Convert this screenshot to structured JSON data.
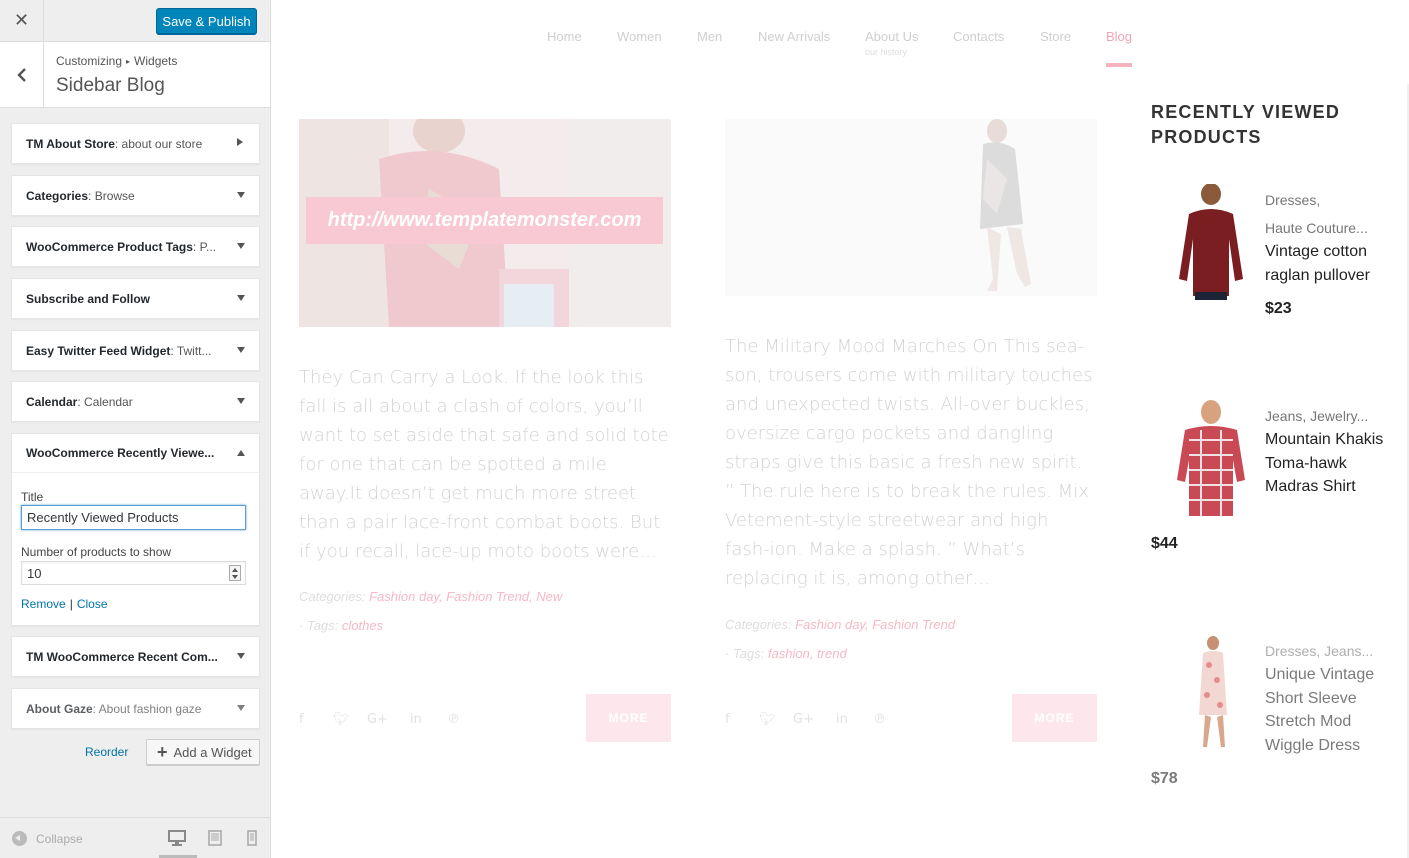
{
  "customizer": {
    "close_icon": "close-icon",
    "save_label": "Save & Publish",
    "breadcrumb": {
      "root": "Customizing",
      "separator": "▸",
      "parent": "Widgets"
    },
    "section_title": "Sidebar Blog",
    "widgets": [
      {
        "name": "TM About Store",
        "title": ": about our store",
        "state": "collapsed-right"
      },
      {
        "name": "Categories",
        "title": ": Browse",
        "state": "collapsed"
      },
      {
        "name": "WooCommerce Product Tags",
        "title": ": P...",
        "state": "collapsed"
      },
      {
        "name": "Subscribe and Follow",
        "title": "",
        "state": "collapsed"
      },
      {
        "name": "Easy Twitter Feed Widget",
        "title": ": Twitt...",
        "state": "collapsed"
      },
      {
        "name": "Calendar",
        "title": ": Calendar",
        "state": "collapsed"
      },
      {
        "name": "WooCommerce Recently Viewe...",
        "title": "",
        "state": "expanded"
      },
      {
        "name": "TM WooCommerce Recent Com...",
        "title": "",
        "state": "collapsed"
      },
      {
        "name": "About Gaze",
        "title": ": About fashion gaze",
        "state": "collapsed"
      }
    ],
    "open_widget": {
      "title_label": "Title",
      "title_value": "Recently Viewed Products",
      "count_label": "Number of products to show",
      "count_value": "10",
      "remove_label": "Remove",
      "separator": "|",
      "close_label": "Close"
    },
    "reorder_label": "Reorder",
    "add_widget_label": "Add a Widget",
    "collapse_label": "Collapse"
  },
  "site": {
    "nav": [
      {
        "label": "Home",
        "sub": ""
      },
      {
        "label": "Women",
        "sub": ""
      },
      {
        "label": "Men",
        "sub": ""
      },
      {
        "label": "New Arrivals",
        "sub": ""
      },
      {
        "label": "About Us",
        "sub": "our history"
      },
      {
        "label": "Contacts",
        "sub": ""
      },
      {
        "label": "Store",
        "sub": ""
      },
      {
        "label": "Blog",
        "sub": "",
        "active": true
      }
    ],
    "posts": [
      {
        "image_banner": "http://www.templatemonster.com",
        "excerpt": "They Can Carry a Look. If the look this fall is all about a clash of colors, you’ll want to set aside that safe and solid tote for one that can be spotted a mile away.It doesn’t get much more street than a pair lace-front combat boots. But if you recall, lace-up moto boots were…",
        "categories_label": "Categories:",
        "categories": "Fashion day, Fashion Trend, New",
        "tags_label": "Tags:",
        "tags": "clothes",
        "more_label": "MORE"
      },
      {
        "image_banner": "",
        "excerpt": "The Military Mood Marches On This sea-son, trousers come with military touches and unexpected twists. All-over buckles, oversize cargo pockets and dangling straps give this basic a fresh new spirit. ” The rule here is to break the rules. Mix Vetement-style streetwear and high fash-ion. Make a splash. ” What’s replacing it is, among other…",
        "categories_label": "Categories:",
        "categories": "Fashion day, Fashion Trend",
        "tags_label": "Tags:",
        "tags": "fashion, trend",
        "more_label": "MORE"
      }
    ],
    "social_icons": [
      "facebook-icon",
      "twitter-icon",
      "google-plus-icon",
      "linkedin-icon",
      "pinterest-icon"
    ],
    "recently_viewed": {
      "title": "RECENTLY VIEWED PRODUCTS",
      "items": [
        {
          "categories_1": "Dresses,",
          "categories_2": "Haute Couture...",
          "name": "Vintage cotton raglan pullover",
          "price": "$23"
        },
        {
          "categories_1": "Jeans, Jewelry...",
          "categories_2": "",
          "name": "Mountain Khakis Toma-hawk Madras Shirt",
          "price": "$44"
        },
        {
          "categories_1": "Dresses, Jeans...",
          "categories_2": "",
          "name": "Unique Vintage Short Sleeve Stretch Mod Wiggle Dress",
          "price": "$78"
        }
      ]
    }
  },
  "colors": {
    "primary_button": "#0085ba",
    "link": "#0073aa",
    "accent_pink": "#f5a3b3",
    "banner_pink": "#f8c9d2"
  }
}
